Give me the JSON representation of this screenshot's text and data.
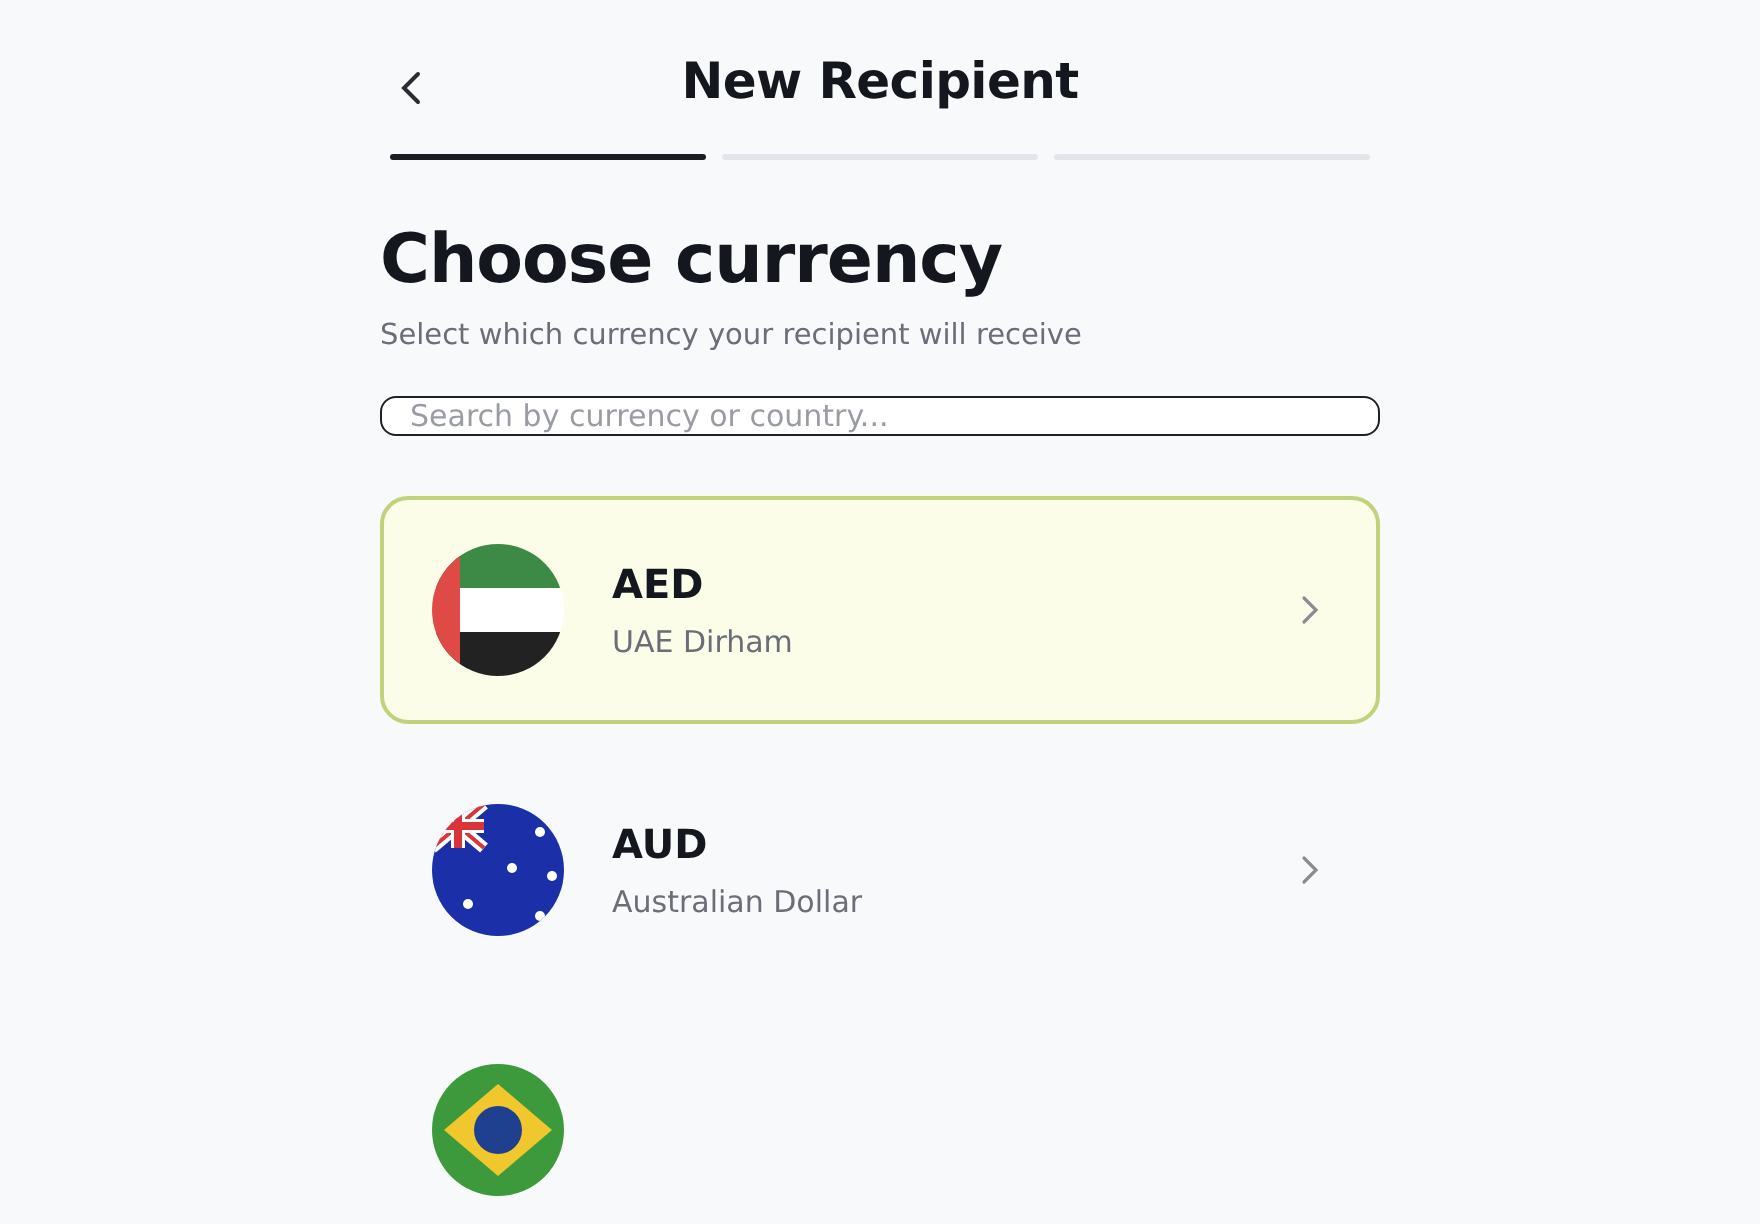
{
  "header": {
    "title": "New Recipient"
  },
  "steps": [
    {
      "done": true
    },
    {
      "done": false
    },
    {
      "done": false
    }
  ],
  "heading": "Choose currency",
  "subtitle": "Select which currency your recipient will receive",
  "search": {
    "placeholder": "Search by currency or country..."
  },
  "currencies": [
    {
      "kind": "uae",
      "code": "AED",
      "name": "UAE Dirham",
      "selected": true
    },
    {
      "kind": "australia",
      "code": "AUD",
      "name": "Australian Dollar",
      "selected": false
    },
    {
      "kind": "brazil",
      "selected": false
    }
  ]
}
